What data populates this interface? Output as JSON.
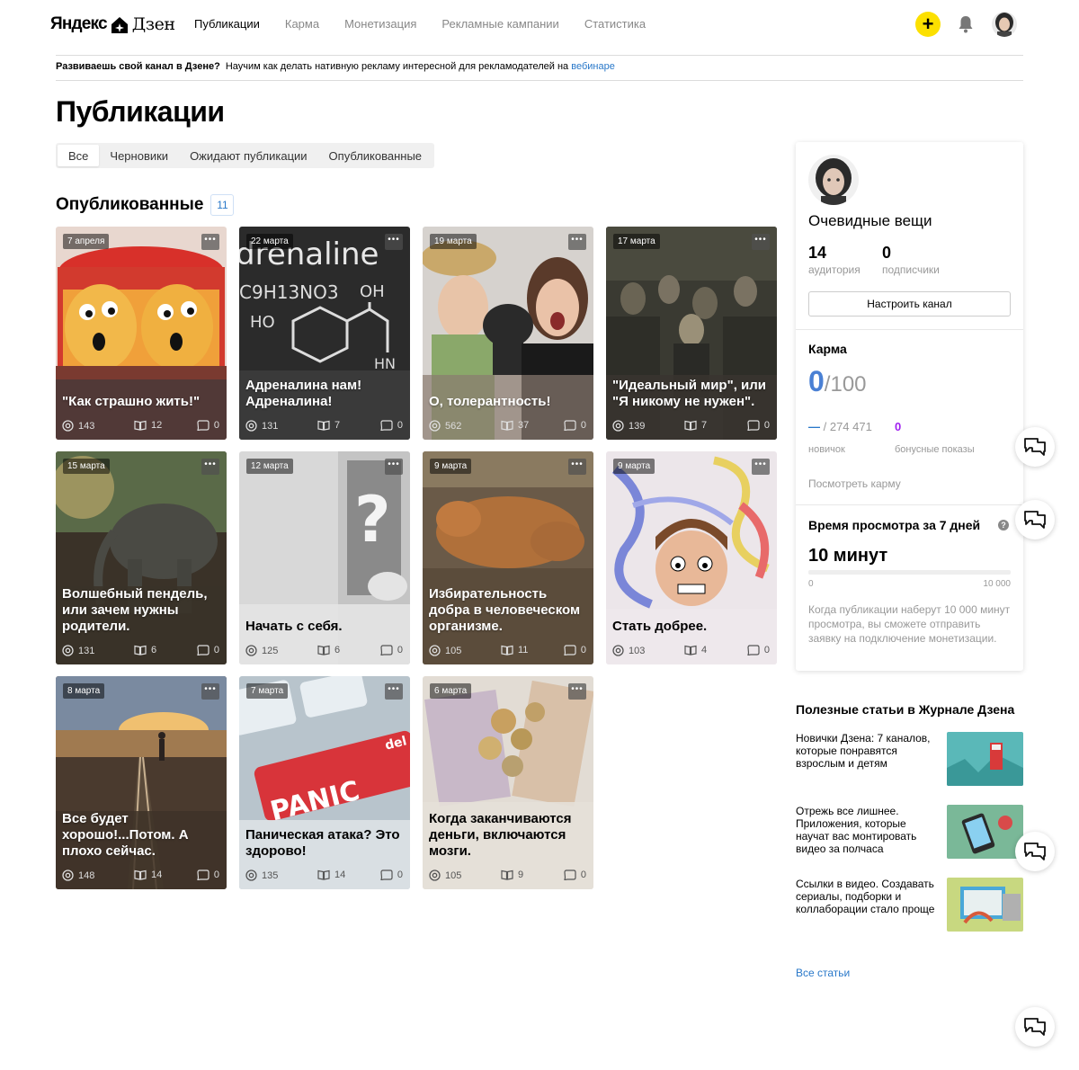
{
  "header": {
    "logo_left": "Яндекс",
    "logo_right": "Дзен",
    "nav": [
      {
        "label": "Публикации"
      },
      {
        "label": "Карма"
      },
      {
        "label": "Монетизация"
      },
      {
        "label": "Рекламные кампании"
      },
      {
        "label": "Статистика"
      }
    ],
    "plus_label": "+"
  },
  "banner": {
    "bold": "Развиваешь свой канал в Дзене?",
    "text": "Научим как делать нативную рекламу интересной для рекламодателей на",
    "link": "вебинаре"
  },
  "page_title": "Публикации",
  "tabs": [
    {
      "label": "Все"
    },
    {
      "label": "Черновики"
    },
    {
      "label": "Ожидают публикации"
    },
    {
      "label": "Опубликованные"
    }
  ],
  "section": {
    "title": "Опубликованные",
    "count": "11"
  },
  "cards": [
    {
      "date": "7 апреля",
      "title": "\"Как страшно жить!\"",
      "views": "143",
      "reads": "12",
      "comments": "0",
      "more": "•••"
    },
    {
      "date": "22 марта",
      "title": "Адреналина нам! Адреналина!",
      "views": "131",
      "reads": "7",
      "comments": "0",
      "more": "•••"
    },
    {
      "date": "19 марта",
      "title": "О, толерантность!",
      "views": "562",
      "reads": "37",
      "comments": "0",
      "more": "•••"
    },
    {
      "date": "17 марта",
      "title": "\"Идеальный мир\", или \"Я никому не нужен\".",
      "views": "139",
      "reads": "7",
      "comments": "0",
      "more": "•••"
    },
    {
      "date": "15 марта",
      "title": "Волшебный пендель, или зачем нужны родители.",
      "views": "131",
      "reads": "6",
      "comments": "0",
      "more": "•••"
    },
    {
      "date": "12 марта",
      "title": "Начать с себя.",
      "views": "125",
      "reads": "6",
      "comments": "0",
      "more": "•••"
    },
    {
      "date": "9 марта",
      "title": "Избирательность добра в человеческом организме.",
      "views": "105",
      "reads": "11",
      "comments": "0",
      "more": "•••"
    },
    {
      "date": "9 марта",
      "title": "Стать добрее.",
      "views": "103",
      "reads": "4",
      "comments": "0",
      "more": "•••"
    },
    {
      "date": "8 марта",
      "title": "Все будет хорошо!...Потом. А плохо сейчас.",
      "views": "148",
      "reads": "14",
      "comments": "0",
      "more": "•••"
    },
    {
      "date": "7 марта",
      "title": "Паническая атака? Это здорово!",
      "views": "135",
      "reads": "14",
      "comments": "0",
      "more": "•••"
    },
    {
      "date": "6 марта",
      "title": "Когда заканчиваются деньги, включаются мозги.",
      "views": "105",
      "reads": "9",
      "comments": "0",
      "more": "•••"
    }
  ],
  "card_art": {
    "adrenaline_word": "drenaline",
    "formula": "C9H13NO3",
    "oh": "OH",
    "ho": "HO",
    "hn": "HN",
    "question": "?",
    "panic": "PANIC",
    "del": "del"
  },
  "panel": {
    "channel_name": "Очевидные вещи",
    "audience_value": "14",
    "audience_label": "аудитория",
    "subscribers_value": "0",
    "subscribers_label": "подписчики",
    "setup_button": "Настроить канал",
    "karma_title": "Карма",
    "karma_score": "0",
    "karma_max": "/100",
    "karma_rank_dash": "—",
    "karma_rank_total": " / 274 471",
    "karma_bonus": "0",
    "karma_rank_label": "новичок",
    "karma_bonus_label": "бонусные показы",
    "karma_see": "Посмотреть карму",
    "watch_title": "Время просмотра за 7 дней",
    "help": "?",
    "watch_value": "10 минут",
    "watch_progress": 0,
    "watch_min": "0",
    "watch_max": "10 000",
    "watch_note": "Когда публикации наберут 10 000 минут просмотра, вы сможете отправить заявку на подключение монетизации."
  },
  "useful": {
    "title": "Полезные статьи в Журнале Дзена",
    "articles": [
      {
        "text": "Новички Дзена: 7 каналов, которые понравятся взрослым и детям"
      },
      {
        "text": "Отрежь все лишнее. Приложения, которые научат вас монтировать видео за полчаса"
      },
      {
        "text": "Ссылки в видео. Создавать сериалы, подборки и коллаборации стало проще"
      }
    ],
    "all_link": "Все статьи"
  },
  "colors": {
    "accent": "#fce000",
    "link": "#2978c9",
    "karma": "#4a80d4",
    "bonus": "#a020f0"
  },
  "icons": [
    "bell-icon",
    "chat-icon",
    "eye-icon",
    "book-icon",
    "comment-icon",
    "more-icon"
  ]
}
